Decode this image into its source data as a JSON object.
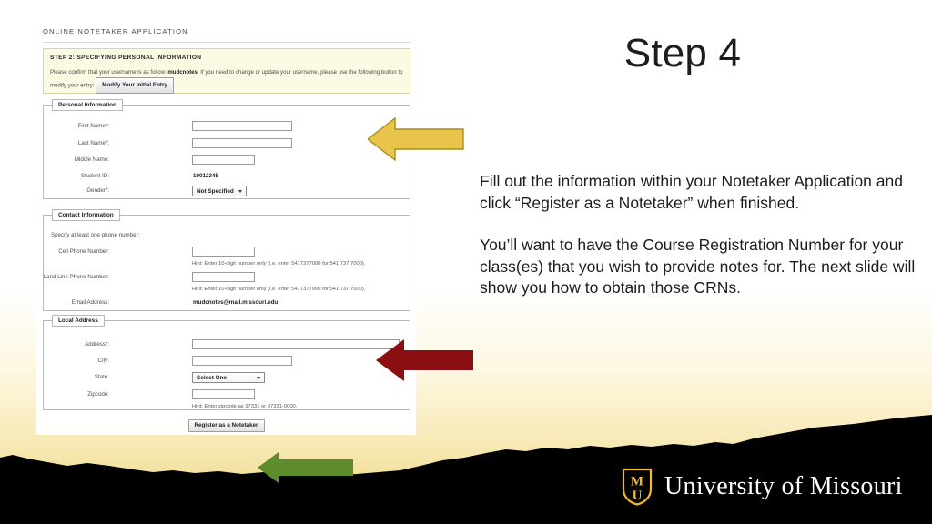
{
  "slide": {
    "title": "Step 4",
    "paragraphs": [
      "Fill out the information within your Notetaker Application and click “Register as a Notetaker” when finished.",
      "You’ll want to have the Course Registration Number for your class(es) that you wish to provide notes for. The next slide will show you how to obtain those CRNs."
    ]
  },
  "branding": {
    "logo_letters_top": "M",
    "logo_letters_bottom": "U",
    "wordmark": "University of Missouri",
    "gold": "#F1B82D",
    "black": "#000000"
  },
  "arrows": [
    {
      "name": "yellow-arrow",
      "color": "#E8C44A",
      "stroke": "#A98B22",
      "direction": "left"
    },
    {
      "name": "red-arrow",
      "color": "#8B0F12",
      "stroke": "#8B0F12",
      "direction": "left"
    },
    {
      "name": "green-arrow",
      "color": "#5E8C2A",
      "stroke": "#5E8C2A",
      "direction": "left"
    }
  ],
  "app": {
    "header": "ONLINE NOTETAKER APPLICATION",
    "step_box": {
      "title": "STEP 2: SPECIFYING PERSONAL INFORMATION",
      "text_before": "Please confirm that your username is as follow: ",
      "username": "mudcnotes",
      "text_after": ". If you need to change or update your username, please use the following button to modify your entry:",
      "button_label": "Modify Your Initial Entry"
    },
    "personal_information": {
      "legend": "Personal Information",
      "fields": [
        {
          "label": "First Name",
          "required": true,
          "type": "input",
          "value": ""
        },
        {
          "label": "Last Name",
          "required": true,
          "type": "input",
          "value": ""
        },
        {
          "label": "Middle Name",
          "required": false,
          "type": "input",
          "value": ""
        },
        {
          "label": "Student ID",
          "required": false,
          "type": "static",
          "value": "10012345"
        },
        {
          "label": "Gender",
          "required": true,
          "type": "select",
          "value": "Not Specified"
        }
      ]
    },
    "contact_information": {
      "legend": "Contact Information",
      "note": "Specify at least one phone number:",
      "fields": [
        {
          "label": "Cell Phone Number",
          "required": false,
          "type": "input",
          "value": "",
          "hint": "Hint: Enter 10-digit number only (i.e. enter 5417377000 for 541 737 7000)."
        },
        {
          "label": "Land Line Phone Number",
          "required": false,
          "type": "input",
          "value": "",
          "hint": "Hint: Enter 10-digit number only (i.e. enter 5417377000 for 541 737 7000)."
        },
        {
          "label": "Email Address",
          "required": false,
          "type": "static",
          "value": "mudcnotes@mail.missouri.edu"
        }
      ]
    },
    "local_address": {
      "legend": "Local Address",
      "fields": [
        {
          "label": "Address",
          "required": true,
          "type": "input",
          "value": ""
        },
        {
          "label": "City",
          "required": false,
          "type": "input",
          "value": ""
        },
        {
          "label": "State",
          "required": false,
          "type": "select",
          "value": "Select One"
        },
        {
          "label": "Zipcode",
          "required": false,
          "type": "input",
          "value": "",
          "hint": "Hint: Enter zipcode as 97331 or 97331-0000."
        }
      ]
    },
    "submit_label": "Register as a Notetaker"
  }
}
